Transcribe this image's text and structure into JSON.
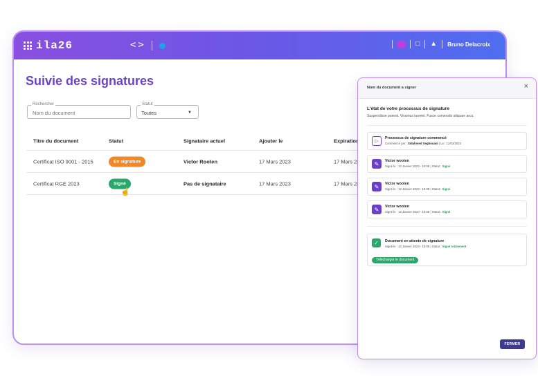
{
  "app": {
    "brand": "ila26",
    "user_name": "Bruno Delacroix",
    "colors": {
      "accent": "#6a44c8",
      "signed": "#2aa86c",
      "in_progress": "#f0882a"
    }
  },
  "page": {
    "title": "Suivie des signatures",
    "search": {
      "label": "Rechercher",
      "placeholder": "Nom du document"
    },
    "status_filter": {
      "label": "Statut",
      "value": "Toutes"
    }
  },
  "table": {
    "headers": [
      "Titre du document",
      "Statut",
      "Signataire actuel",
      "Ajouter le",
      "Expiration"
    ],
    "rows": [
      {
        "title": "Certificat ISO 9001 - 2015",
        "status": "En signature",
        "signer": "Victor Rooten",
        "added": "17 Mars 2023",
        "expiration": "17 Mars 20"
      },
      {
        "title": "Certificat RGE 2023",
        "status": "Signé",
        "signer": "Pas de signataire",
        "added": "17 Mars 2023",
        "expiration": "17 Mars 20"
      }
    ]
  },
  "panel": {
    "header": "Nom du document a signer",
    "title": "L'état de votre processus de signature",
    "subtitle": "Suspendisse potenti. Vivamus laoreet. Fusce commodo aliquam arcu.",
    "start": {
      "title": "Processus de signature commencé",
      "by_label": "Commencé par :",
      "by": "Sidahmed Seghouani",
      "date_label": "Le : 12/03/2023"
    },
    "signers": [
      {
        "name": "Victor wooten",
        "signed_label": "Signé le :",
        "date": "12 Janvier 2023 - 10:08",
        "status_label": "Statut :",
        "status": "Signé"
      },
      {
        "name": "Victor wooten",
        "signed_label": "Signé le :",
        "date": "12 Janvier 2023 - 10:08",
        "status_label": "Statut :",
        "status": "Signé"
      },
      {
        "name": "Victor wooten",
        "signed_label": "Signé le :",
        "date": "12 Janvier 2023 - 10:08",
        "status_label": "Statut :",
        "status": "Signé"
      }
    ],
    "document": {
      "title": "Document en attente de signature",
      "signed_label": "Signé le :",
      "date": "12 Janvier 2023 - 10:08",
      "status_label": "Statut :",
      "status": "Signé totalement",
      "download_label": "Télécharger le document"
    },
    "close_label": "FERMER"
  }
}
